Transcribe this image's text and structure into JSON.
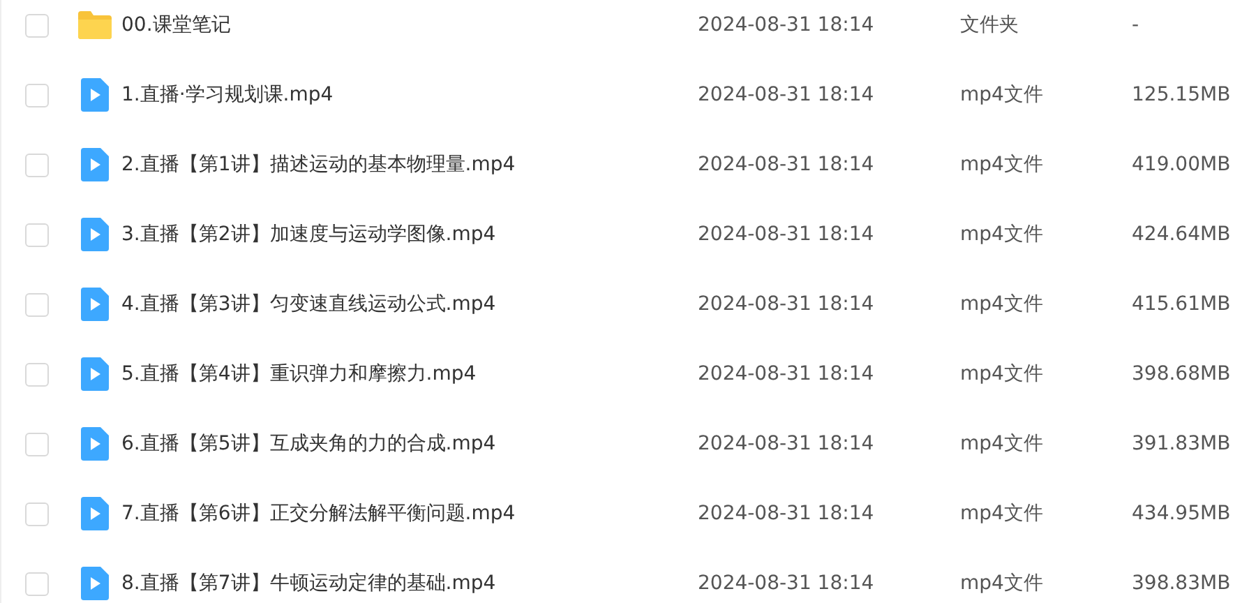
{
  "files": [
    {
      "kind": "folder",
      "selected": false,
      "name": "00.课堂笔记",
      "modified": "2024-08-31 18:14",
      "type": "文件夹",
      "size": "-"
    },
    {
      "kind": "video",
      "selected": false,
      "name": "1.直播·学习规划课.mp4",
      "modified": "2024-08-31 18:14",
      "type": "mp4文件",
      "size": "125.15MB"
    },
    {
      "kind": "video",
      "selected": false,
      "name": "2.直播【第1讲】描述运动的基本物理量.mp4",
      "modified": "2024-08-31 18:14",
      "type": "mp4文件",
      "size": "419.00MB"
    },
    {
      "kind": "video",
      "selected": false,
      "name": "3.直播【第2讲】加速度与运动学图像.mp4",
      "modified": "2024-08-31 18:14",
      "type": "mp4文件",
      "size": "424.64MB"
    },
    {
      "kind": "video",
      "selected": false,
      "name": "4.直播【第3讲】匀变速直线运动公式.mp4",
      "modified": "2024-08-31 18:14",
      "type": "mp4文件",
      "size": "415.61MB"
    },
    {
      "kind": "video",
      "selected": false,
      "name": "5.直播【第4讲】重识弹力和摩擦力.mp4",
      "modified": "2024-08-31 18:14",
      "type": "mp4文件",
      "size": "398.68MB"
    },
    {
      "kind": "video",
      "selected": false,
      "name": "6.直播【第5讲】互成夹角的力的合成.mp4",
      "modified": "2024-08-31 18:14",
      "type": "mp4文件",
      "size": "391.83MB"
    },
    {
      "kind": "video",
      "selected": false,
      "name": "7.直播【第6讲】正交分解法解平衡问题.mp4",
      "modified": "2024-08-31 18:14",
      "type": "mp4文件",
      "size": "434.95MB"
    },
    {
      "kind": "video",
      "selected": false,
      "name": "8.直播【第7讲】牛顿运动定律的基础.mp4",
      "modified": "2024-08-31 18:14",
      "type": "mp4文件",
      "size": "398.83MB"
    }
  ]
}
